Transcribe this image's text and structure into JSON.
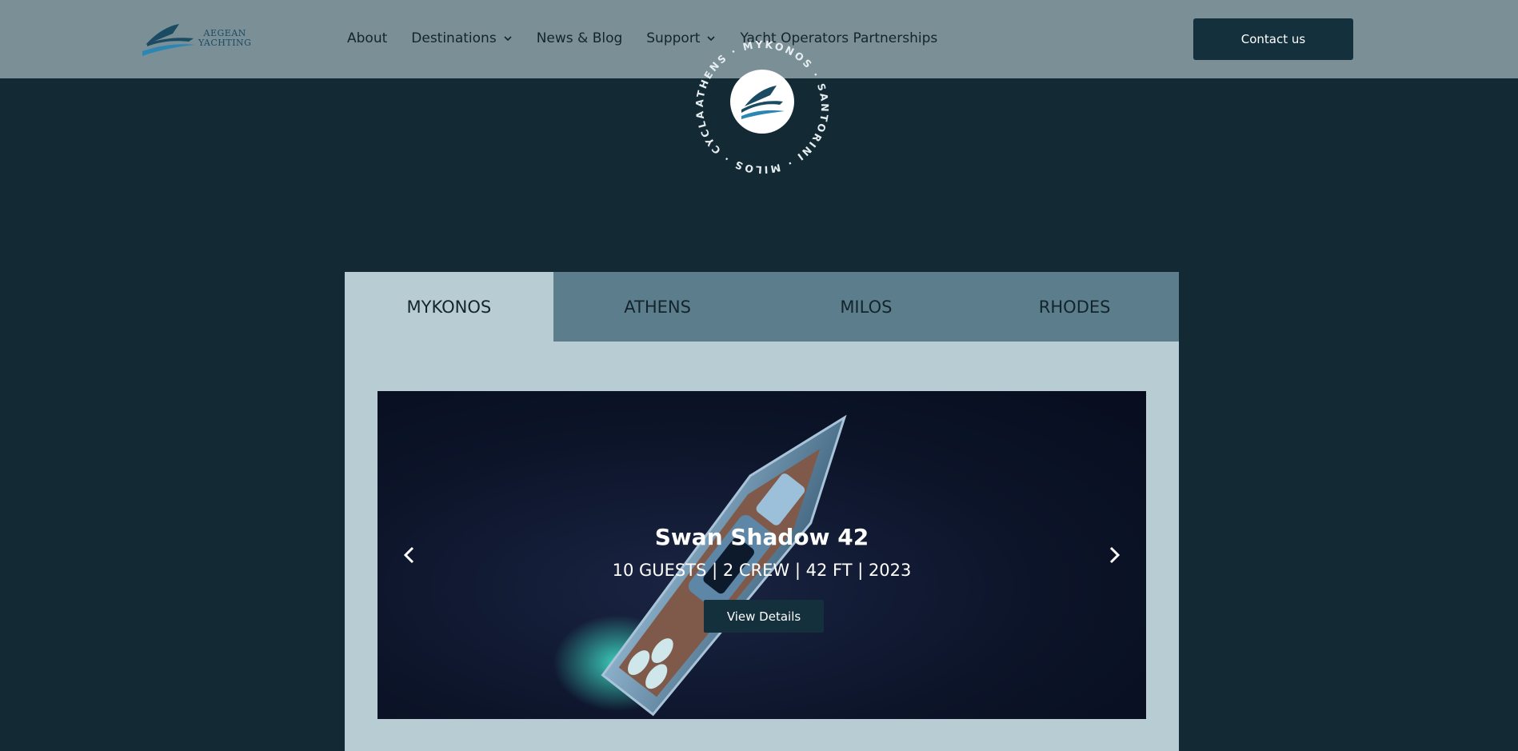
{
  "header": {
    "logo": {
      "line1": "AEGEAN",
      "line2": "YACHTING"
    },
    "nav": [
      {
        "label": "About",
        "icon": null
      },
      {
        "label": "Destinations",
        "icon": "chevron-down-icon"
      },
      {
        "label": "News & Blog",
        "icon": null
      },
      {
        "label": "Support",
        "icon": "chevron-down-icon"
      },
      {
        "label": "Yacht Operators Partnerships",
        "icon": null
      }
    ],
    "contact_label": "Contact us"
  },
  "badge": {
    "words": [
      "ATHENS",
      "MYKONOS",
      "SANTORINI",
      "MILOS",
      "CYCLADES"
    ],
    "icon": "yacht-logo-icon"
  },
  "tabs": [
    {
      "label": "MYKONOS",
      "active": true
    },
    {
      "label": "ATHENS",
      "active": false
    },
    {
      "label": "MILOS",
      "active": false
    },
    {
      "label": "RHODES",
      "active": false
    }
  ],
  "slide": {
    "title": "Swan Shadow 42",
    "specs": "10 GUESTS | 2 CREW | 42 FT | 2023",
    "button_label": "View Details",
    "prev_icon": "chevron-left-icon",
    "next_icon": "chevron-right-icon"
  },
  "colors": {
    "header_bg": "#7b8f96",
    "page_bg": "#132a35",
    "primary": "#13303c",
    "panel_bg": "#b8cdd3",
    "tab_inactive": "#5c7e8c"
  }
}
